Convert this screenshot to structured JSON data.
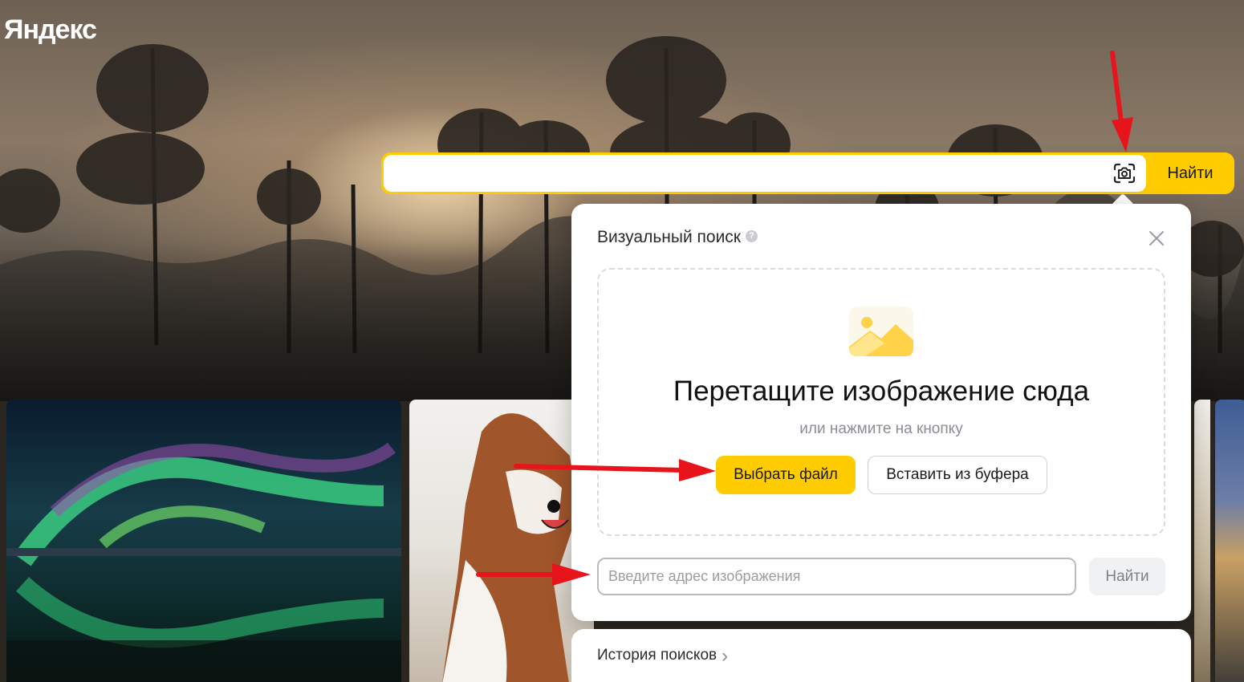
{
  "header": {
    "logo": "Яндекс"
  },
  "search": {
    "value": "",
    "camera_icon": "camera-icon",
    "submit_label": "Найти"
  },
  "visual_search": {
    "title": "Визуальный поиск",
    "help_icon": "?",
    "drop_title": "Перетащите изображение сюда",
    "drop_subtitle": "или нажмите на кнопку",
    "choose_file_label": "Выбрать файл",
    "paste_label": "Вставить из буфера",
    "url_placeholder": "Введите адрес изображения",
    "url_submit_label": "Найти",
    "history_label": "История поисков",
    "history_chevron": "›"
  },
  "colors": {
    "accent": "#ffcc00",
    "annotation_arrow": "#e8141b"
  }
}
